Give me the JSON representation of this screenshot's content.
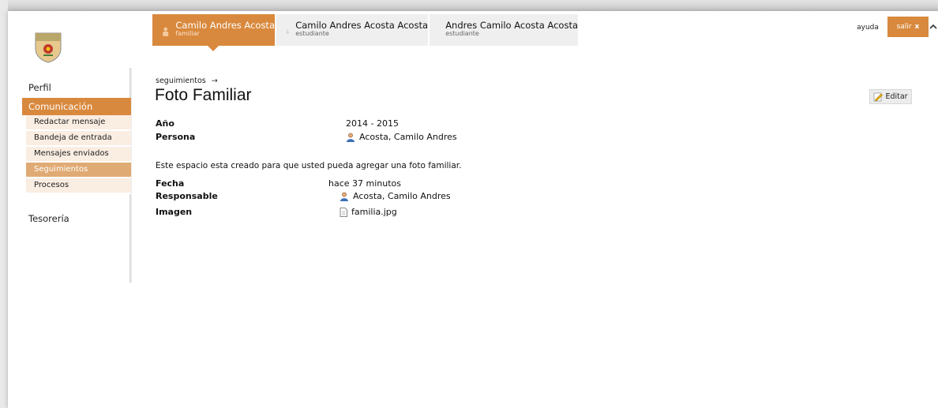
{
  "tabs": [
    {
      "name": "Camilo Andres Acosta",
      "role": "familiar",
      "active": true
    },
    {
      "name": "Camilo Andres Acosta Acosta",
      "role": "estudiante",
      "active": false
    },
    {
      "name": "Andres Camilo Acosta Acosta",
      "role": "estudiante",
      "active": false
    }
  ],
  "header": {
    "help_label": "ayuda",
    "exit_label": "salir",
    "exit_icon": "x"
  },
  "sidebar": {
    "perfil": "Perfil",
    "comunicacion": "Comunicación",
    "items": [
      "Redactar mensaje",
      "Bandeja de entrada",
      "Mensajes enviados",
      "Seguimientos",
      "Procesos"
    ],
    "active_item": "Seguimientos",
    "tesoreria": "Tesorería"
  },
  "main": {
    "breadcrumb": "seguimientos",
    "breadcrumb_arrow": "→",
    "title": "Foto Familiar",
    "edit_label": "Editar",
    "fields": {
      "anio_label": "Año",
      "anio_value": "2014 - 2015",
      "persona_label": "Persona",
      "persona_value": "Acosta, Camilo Andres",
      "description": "Este espacio esta creado para que usted pueda agregar una foto familiar.",
      "fecha_label": "Fecha",
      "fecha_value": "hace 37 minutos",
      "responsable_label": "Responsable",
      "responsable_value": "Acosta, Camilo Andres",
      "imagen_label": "Imagen",
      "imagen_value": "familia.jpg"
    }
  },
  "colors": {
    "accent": "#d9893d",
    "accent_light": "#e0aa74",
    "submenu_bg": "#faede2"
  }
}
